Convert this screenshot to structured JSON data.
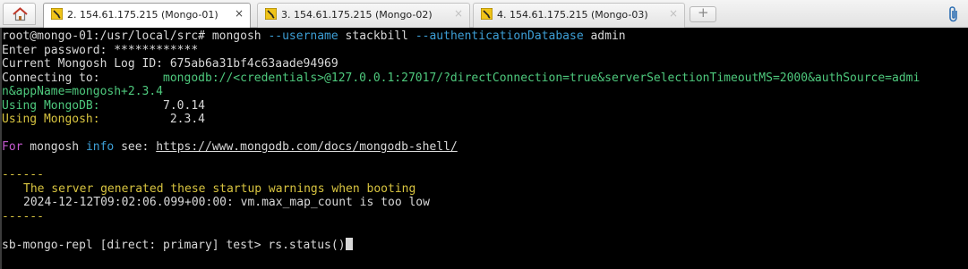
{
  "tabs": [
    {
      "label": "2. 154.61.175.215 (Mongo-01)",
      "active": true
    },
    {
      "label": "3. 154.61.175.215 (Mongo-02)",
      "active": false
    },
    {
      "label": "4. 154.61.175.215 (Mongo-03)",
      "active": false
    }
  ],
  "tab_close_glyph": "×",
  "new_tab_glyph": "+",
  "icons": {
    "home": "home-icon",
    "tab": "terminal-session-icon",
    "close": "close-icon",
    "new_tab": "new-tab-icon",
    "attach": "paperclip-icon"
  },
  "colors": {
    "green": "#4ec97d",
    "yellow": "#d8c440",
    "magenta": "#c65ad0",
    "cyan": "#3d9fd6",
    "text": "#d8d8d8"
  },
  "terminal": {
    "command_line": "root@mongo-01:/usr/local/src# mongosh --username stackbill --authenticationDatabase admin",
    "prompt": "root@mongo-01:/usr/local/src# ",
    "cmd": "mongosh ",
    "opt_username": "--username",
    "username": " stackbill ",
    "opt_authdb": "--authenticationDatabase",
    "authdb": " admin",
    "password_line": "Enter password: ************",
    "log_id_line": "Current Mongosh Log ID: 675ab6a31bf4c63aade94969",
    "connecting_label": "Connecting to:",
    "connecting_pad": "         ",
    "connecting_uri_1": "mongodb://<credentials>@127.0.0.1:27017/?directConnection=true&serverSelectionTimeoutMS=2000&authSource=admi",
    "connecting_uri_2": "n&appName=mongosh+2.3.4",
    "mongodb_label": "Using MongoDB:",
    "mongodb_version": "         7.0.14",
    "mongosh_label": "Using Mongosh:",
    "mongosh_version": "          2.3.4",
    "info_for": "For",
    "info_mongosh": " mongosh ",
    "info_word": "info",
    "info_see": " see: ",
    "info_url": "https://www.mongodb.com/docs/mongodb-shell/",
    "separator": "------",
    "warning_title": "The server generated these startup warnings when booting",
    "warning_detail": "2024-12-12T09:02:06.099+00:00: vm.max_map_count is too low",
    "repl_prompt": "sb-mongo-repl [direct: primary] test> ",
    "repl_command": "rs.status()"
  }
}
